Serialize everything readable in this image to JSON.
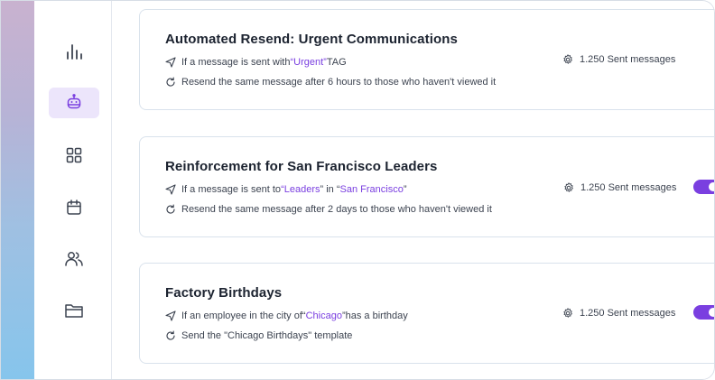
{
  "sidebar": {
    "items": [
      {
        "icon": "analytics-icon",
        "active": false
      },
      {
        "icon": "robot-icon",
        "active": true
      },
      {
        "icon": "grid-icon",
        "active": false
      },
      {
        "icon": "calendar-icon",
        "active": false
      },
      {
        "icon": "users-icon",
        "active": false
      },
      {
        "icon": "folder-icon",
        "active": false
      }
    ]
  },
  "accent_color": "#7a3fe0",
  "rules": [
    {
      "title": "Automated Resend: Urgent Communications",
      "trigger": {
        "pre": "If a message is sent with ",
        "q1": "“",
        "tag": "Urgent",
        "q2": "”",
        "post": " TAG"
      },
      "action": "Resend the same message after 6 hours to those who haven't viewed it",
      "stats": "1.250 Sent messages",
      "toggle_on": true
    },
    {
      "title": "Reinforcement for San Francisco Leaders",
      "trigger": {
        "pre": "If a message is sent to ",
        "q1": "“",
        "group": "Leaders",
        "mid": "” in “",
        "city": "San Francisco",
        "q2": "”"
      },
      "action": "Resend the same message after 2 days to those who haven't viewed it",
      "stats": "1.250 Sent messages",
      "toggle_on": true
    },
    {
      "title": "Factory Birthdays",
      "trigger": {
        "pre": "If an employee in the city of ",
        "q1": "“",
        "city": "Chicago",
        "q2": "”",
        "post": " has a birthday"
      },
      "action": "Send the \"Chicago Birthdays\" template",
      "stats": "1.250 Sent messages",
      "toggle_on": true
    }
  ]
}
